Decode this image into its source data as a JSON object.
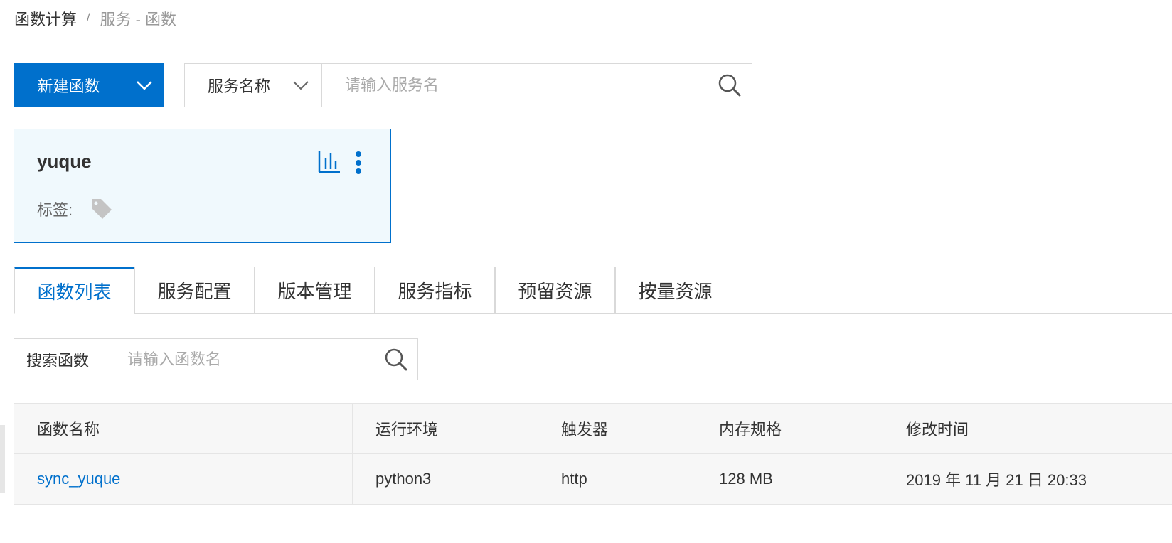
{
  "breadcrumb": {
    "root": "函数计算",
    "separator": "/",
    "current": "服务 - 函数"
  },
  "toolbar": {
    "new_function_label": "新建函数",
    "search_field_select": "服务名称",
    "search_placeholder": "请输入服务名"
  },
  "service_card": {
    "name": "yuque",
    "tags_label": "标签:"
  },
  "tabs": [
    {
      "label": "函数列表",
      "active": true
    },
    {
      "label": "服务配置"
    },
    {
      "label": "版本管理"
    },
    {
      "label": "服务指标"
    },
    {
      "label": "预留资源"
    },
    {
      "label": "按量资源"
    }
  ],
  "function_search": {
    "label": "搜索函数",
    "placeholder": "请输入函数名"
  },
  "table": {
    "columns": [
      "函数名称",
      "运行环境",
      "触发器",
      "内存规格",
      "修改时间"
    ],
    "rows": [
      [
        "sync_yuque",
        "python3",
        "http",
        "128 MB",
        "2019 年 11 月 21 日 20:33"
      ]
    ]
  },
  "colors": {
    "accent": "#0070cc",
    "card_bg": "#f0f9fd",
    "border": "#d9d9d9"
  }
}
